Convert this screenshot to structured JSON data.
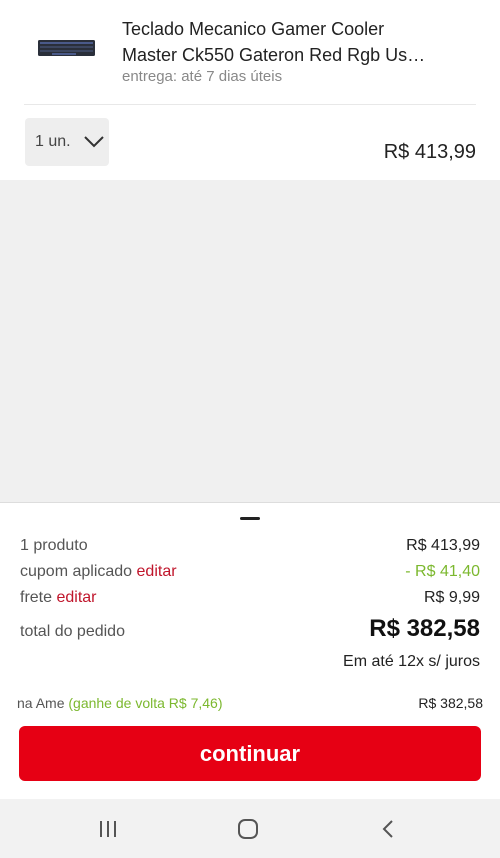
{
  "product": {
    "title_line1": "Teclado Mecanico Gamer Cooler",
    "title_line2": "Master Ck550 Gateron Red Rgb Us…",
    "delivery": "entrega: até 7 dias úteis",
    "quantity": "1 un.",
    "price": "R$ 413,99",
    "thumbnail_icon": "keyboard-icon"
  },
  "summary": {
    "products_label": "1 produto",
    "products_value": "R$ 413,99",
    "coupon_label": "cupom aplicado",
    "coupon_edit": "editar",
    "coupon_value": "- R$ 41,40",
    "shipping_label": "frete",
    "shipping_edit": "editar",
    "shipping_value": "R$ 9,99",
    "total_label": "total do pedido",
    "total_value": "R$ 382,58",
    "installments": "Em até 12x s/ juros",
    "ame_label": "na Ame",
    "ame_cashback": "(ganhe de volta R$ 7,46)",
    "ame_value": "R$ 382,58",
    "continue_label": "continuar"
  },
  "navbar": {
    "recent_icon": "recent-apps-icon",
    "home_icon": "home-icon",
    "back_icon": "back-icon"
  },
  "colors": {
    "accent_red": "#e60014",
    "edit_red": "#c0152b",
    "discount_green": "#7cb82f"
  }
}
